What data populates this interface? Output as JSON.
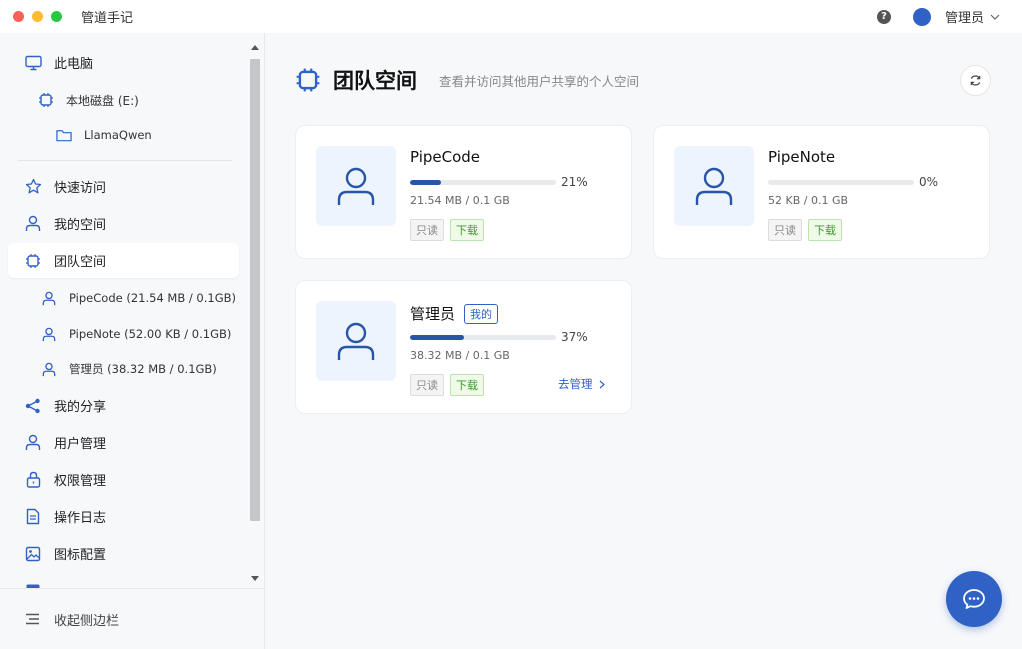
{
  "window": {
    "title": "管道手记"
  },
  "header": {
    "user_name": "管理员",
    "help_symbol": "?"
  },
  "sidebar": {
    "this_pc": "此电脑",
    "local_disk": "本地磁盘 (E:)",
    "folder": "LlamaQwen",
    "items": [
      {
        "label": "快速访问",
        "icon": "star-icon"
      },
      {
        "label": "我的空间",
        "icon": "user-icon"
      },
      {
        "label": "团队空间",
        "icon": "chip-icon",
        "active": true
      }
    ],
    "team_subitems": [
      {
        "label": "PipeCode (21.54 MB / 0.1GB)"
      },
      {
        "label": "PipeNote (52.00 KB / 0.1GB)"
      },
      {
        "label": "管理员 (38.32 MB / 0.1GB)"
      }
    ],
    "items2": [
      {
        "label": "我的分享",
        "icon": "share-icon"
      },
      {
        "label": "用户管理",
        "icon": "user-icon"
      },
      {
        "label": "权限管理",
        "icon": "lock-icon"
      },
      {
        "label": "操作日志",
        "icon": "document-icon"
      },
      {
        "label": "图标配置",
        "icon": "image-icon"
      }
    ],
    "collapse_label": "收起侧边栏"
  },
  "main": {
    "title": "团队空间",
    "subtitle": "查看并访问其他用户共享的个人空间",
    "cards": [
      {
        "name": "PipeCode",
        "percent": "21%",
        "progress": 0.21,
        "size": "21.54 MB / 0.1 GB",
        "tag_readonly": "只读",
        "tag_download": "下载"
      },
      {
        "name": "PipeNote",
        "percent": "0%",
        "progress": 0,
        "size": "52 KB / 0.1 GB",
        "tag_readonly": "只读",
        "tag_download": "下载"
      },
      {
        "name": "管理员",
        "badge": "我的",
        "percent": "37%",
        "progress": 0.37,
        "size": "38.32 MB / 0.1 GB",
        "tag_readonly": "只读",
        "tag_download": "下载",
        "manage": "去管理"
      }
    ]
  },
  "colors": {
    "accent": "#2f62c4",
    "progress": "#2856a6",
    "download_tag": "#3d9a2a"
  }
}
